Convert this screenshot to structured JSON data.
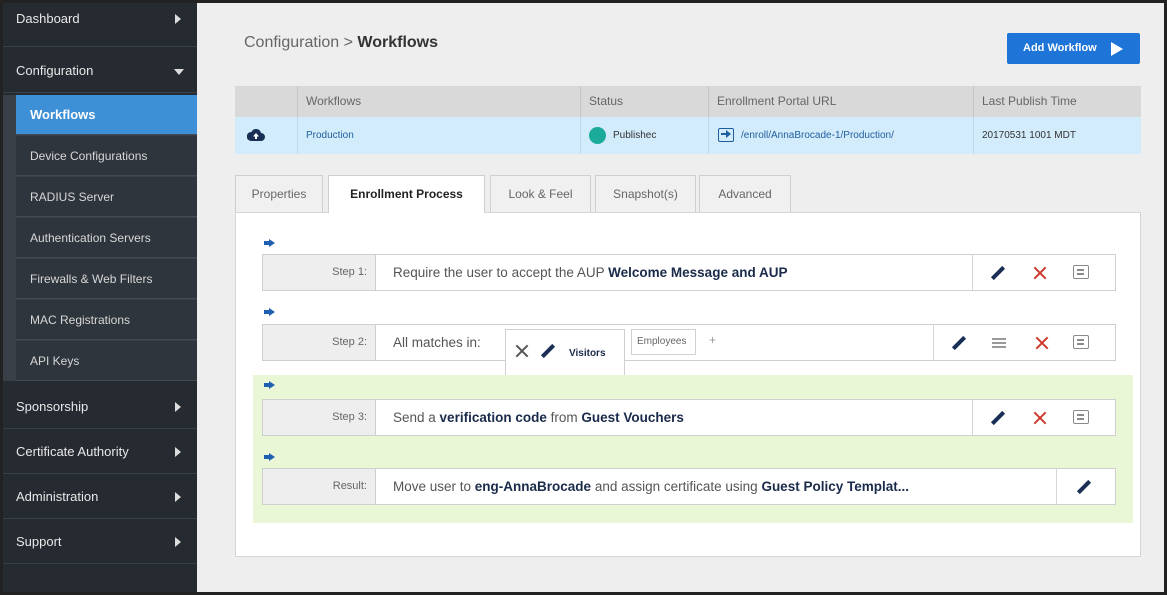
{
  "sidebar": {
    "items": [
      {
        "label": "Dashboard"
      },
      {
        "label": "Configuration"
      },
      {
        "label": "Sponsorship"
      },
      {
        "label": "Certificate Authority"
      },
      {
        "label": "Administration"
      },
      {
        "label": "Support"
      }
    ],
    "sub_items": [
      {
        "label": "Workflows"
      },
      {
        "label": "Device Configurations"
      },
      {
        "label": "RADIUS Server"
      },
      {
        "label": "Authentication Servers"
      },
      {
        "label": "Firewalls & Web Filters"
      },
      {
        "label": "MAC Registrations"
      },
      {
        "label": "API Keys"
      }
    ]
  },
  "breadcrumb": {
    "parent": "Configuration",
    "sep": ">",
    "current": "Workflows"
  },
  "add_button": {
    "label": "Add Workflow"
  },
  "workflows_table": {
    "headers": [
      "Workflows",
      "Status",
      "Enrollment Portal URL",
      "Last Publish Time"
    ],
    "row": {
      "name": "Production",
      "status": "Publishec",
      "url": "/enroll/AnnaBrocade-1/Production/",
      "time": "20170531 1001 MDT"
    }
  },
  "tabs": [
    "Properties",
    "Enrollment Process",
    "Look & Feel",
    "Snapshot(s)",
    "Advanced"
  ],
  "steps": {
    "step1": {
      "label": "Step 1:",
      "text": "Require the user to accept the AUP ",
      "bold": "Welcome Message and AUP"
    },
    "step2": {
      "label": "Step 2:",
      "text": "All matches in:",
      "visitors": "Visitors",
      "employees": "Employees",
      "plus": "+"
    },
    "step3": {
      "label": "Step 3:",
      "t1": "Send a ",
      "b1": "verification code",
      "t2": " from ",
      "b2": "Guest Vouchers"
    },
    "result": {
      "label": "Result:",
      "t1": "Move user to ",
      "b1": "eng-AnnaBrocade",
      "t2": " and assign certificate using ",
      "b2": "Guest Policy Templat..."
    }
  },
  "colors": {
    "sidebar_bg": "#262b31",
    "active_blue": "#3d8fd6",
    "button_blue": "#1f74d8",
    "published_teal": "#1bab9b",
    "delete_red": "#d03a2c",
    "highlight_green": "#eaf7d6"
  },
  "icons": [
    "chevron-right-icon",
    "chevron-down-icon",
    "cloud-upload-icon",
    "portal-link-icon",
    "pencil-icon",
    "close-icon",
    "comment-icon",
    "menu-icon",
    "arrow-right-icon"
  ]
}
